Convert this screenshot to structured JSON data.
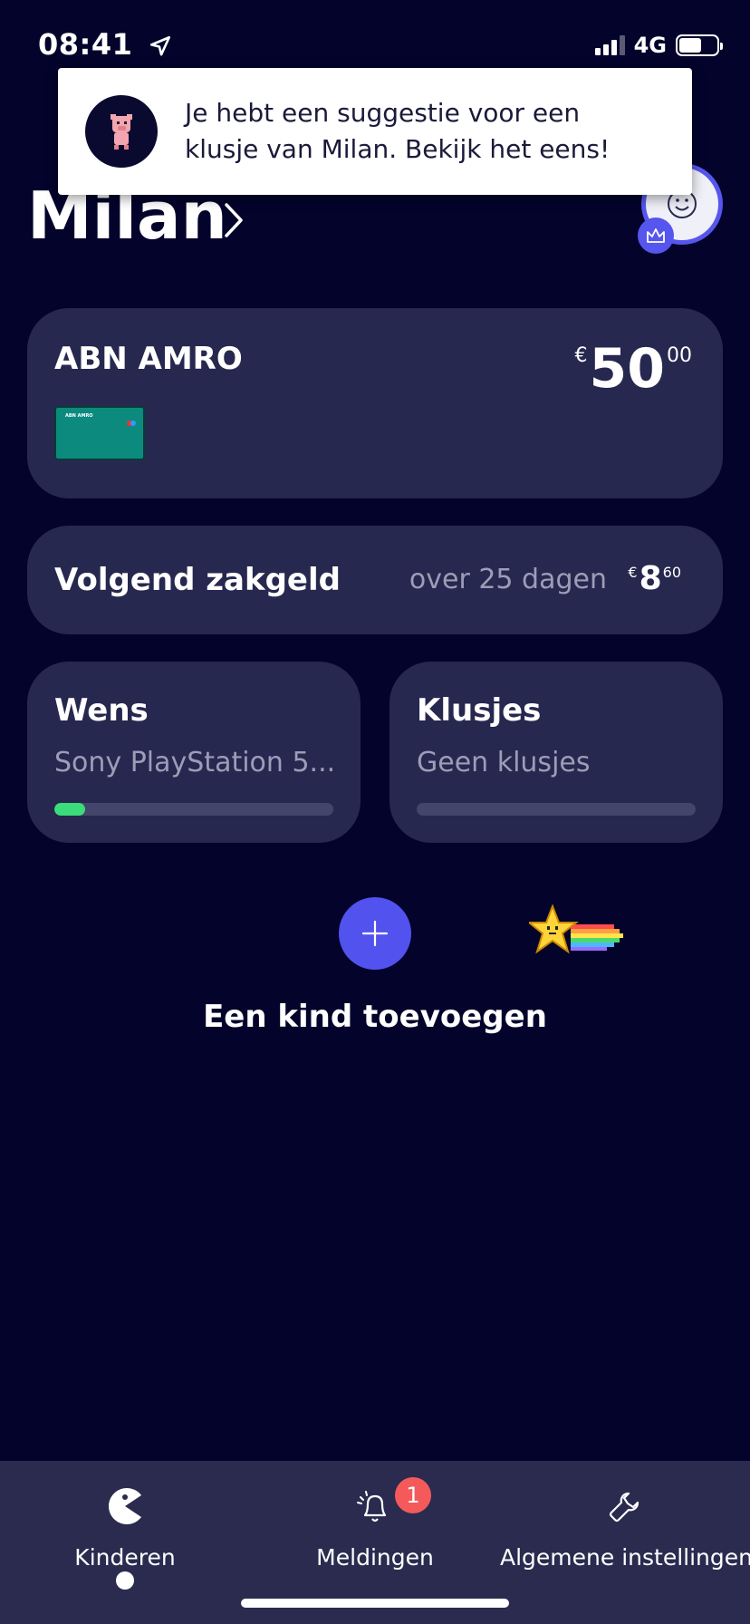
{
  "status": {
    "time": "08:41",
    "network": "4G"
  },
  "toast": {
    "message": "Je hebt een suggestie voor een klusje van Milan. Bekijk het eens!"
  },
  "header": {
    "child_name": "Milan"
  },
  "bank": {
    "name": "ABN AMRO",
    "currency": "€",
    "amount_int": "50",
    "amount_dec": "00",
    "mini_card_label": "ABN AMRO"
  },
  "allowance": {
    "label": "Volgend zakgeld",
    "when": "over 25 dagen",
    "currency": "€",
    "amount_int": "8",
    "amount_dec": "60"
  },
  "wish": {
    "title": "Wens",
    "subtitle": "Sony PlayStation 5...",
    "progress": 0.11
  },
  "chores": {
    "title": "Klusjes",
    "subtitle": "Geen klusjes",
    "progress": 0
  },
  "add_child": {
    "label": "Een kind toevoegen"
  },
  "tabs": [
    {
      "label": "Kinderen",
      "icon": "pacman-icon",
      "active": true
    },
    {
      "label": "Meldingen",
      "icon": "bell-icon",
      "badge": "1"
    },
    {
      "label": "Algemene instellingen",
      "icon": "wrench-icon"
    }
  ],
  "colors": {
    "background": "#03032c",
    "card": "#27284f",
    "accent": "#5252ee",
    "progress": "#3bdc7a",
    "badge": "#f45a5a"
  }
}
